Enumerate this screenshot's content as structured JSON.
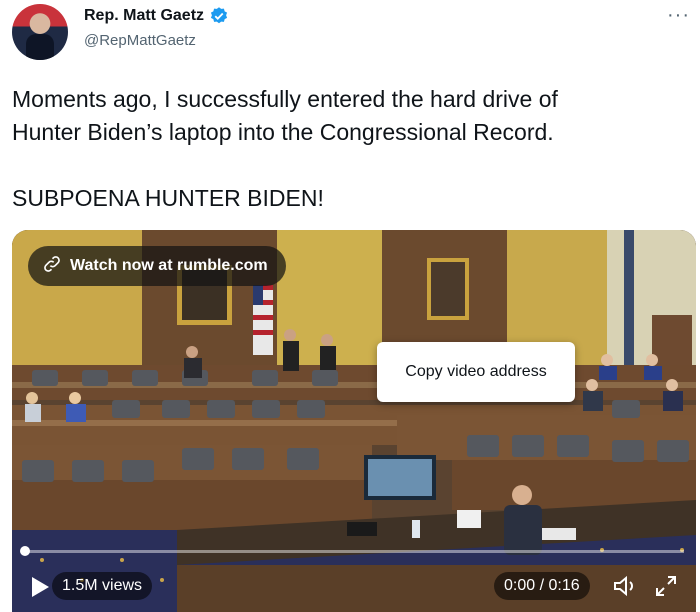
{
  "author": {
    "display_name": "Rep. Matt Gaetz",
    "handle": "@RepMattGaetz",
    "verified": true
  },
  "more_menu": "···",
  "tweet": {
    "text": "Moments ago, I successfully entered the hard drive of\nHunter Biden’s laptop into the Congressional Record.\n\nSUBPOENA HUNTER BIDEN!"
  },
  "media": {
    "watch_link": "Watch now at rumble.com",
    "context_menu_item": "Copy video address",
    "views": "1.5M views",
    "time": "0:00 / 0:16",
    "progress": 0
  },
  "icons": {
    "verified": "verified-badge-icon",
    "link": "link-icon",
    "play": "play-icon",
    "volume": "volume-icon",
    "fullscreen": "fullscreen-icon",
    "more": "more-icon"
  },
  "colors": {
    "verified": "#1d9bf0",
    "text": "#0f1419",
    "secondary": "#536471"
  }
}
